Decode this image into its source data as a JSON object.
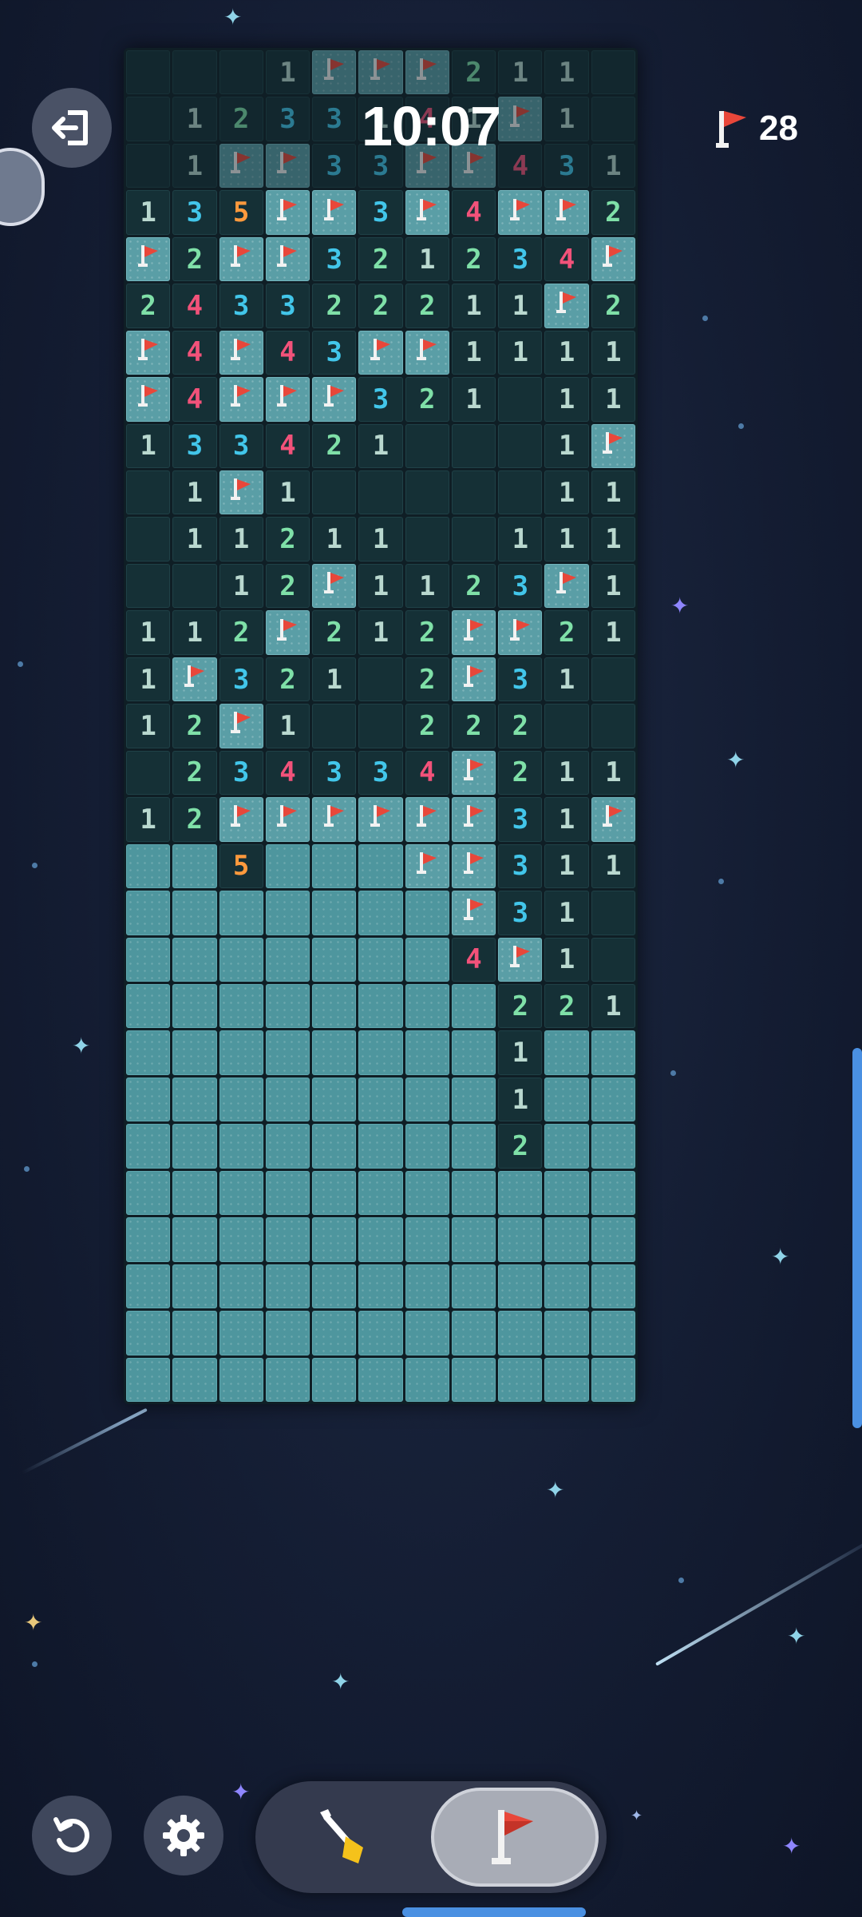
{
  "timer": "10:07",
  "flags_remaining": "28",
  "board": {
    "rows": [
      [
        " ",
        " ",
        " ",
        "1",
        "F",
        "F",
        "F",
        "2",
        "1",
        "1",
        " "
      ],
      [
        " ",
        "1",
        "2",
        "3",
        "3",
        "1",
        "4",
        "1",
        "F",
        "1",
        " "
      ],
      [
        " ",
        "1",
        "F",
        "F",
        "3",
        "3",
        "F",
        "F",
        "4",
        "3",
        "1"
      ],
      [
        "1",
        "3",
        "5",
        "F",
        "F",
        "3",
        "F",
        "4",
        "F",
        "F",
        "2"
      ],
      [
        "F",
        "2",
        "F",
        "F",
        "3",
        "2",
        "1",
        "2",
        "3",
        "4",
        "F"
      ],
      [
        "2",
        "4",
        "3",
        "3",
        "2",
        "2",
        "2",
        "1",
        "1",
        "F",
        "2"
      ],
      [
        "F",
        "4",
        "F",
        "4",
        "3",
        "F",
        "F",
        "1",
        "1",
        "1",
        "1"
      ],
      [
        "F",
        "4",
        "F",
        "F",
        "F",
        "3",
        "2",
        "1",
        " ",
        "1",
        "1"
      ],
      [
        "1",
        "3",
        "3",
        "4",
        "2",
        "1",
        " ",
        " ",
        " ",
        "1",
        "F"
      ],
      [
        " ",
        "1",
        "F",
        "1",
        " ",
        " ",
        " ",
        " ",
        " ",
        "1",
        "1"
      ],
      [
        " ",
        "1",
        "1",
        "2",
        "1",
        "1",
        " ",
        " ",
        "1",
        "1",
        "1"
      ],
      [
        " ",
        " ",
        "1",
        "2",
        "F",
        "1",
        "1",
        "2",
        "3",
        "F",
        "1"
      ],
      [
        "1",
        "1",
        "2",
        "F",
        "2",
        "1",
        "2",
        "F",
        "F",
        "2",
        "1"
      ],
      [
        "1",
        "F",
        "3",
        "2",
        "1",
        " ",
        "2",
        "F",
        "3",
        "1",
        " "
      ],
      [
        "1",
        "2",
        "F",
        "1",
        " ",
        " ",
        "2",
        "2",
        "2",
        " ",
        " "
      ],
      [
        " ",
        "2",
        "3",
        "4",
        "3",
        "3",
        "4",
        "F",
        "2",
        "1",
        "1"
      ],
      [
        "1",
        "2",
        "F",
        "F",
        "F",
        "F",
        "F",
        "F",
        "3",
        "1",
        "F"
      ],
      [
        "H",
        "H",
        "5",
        "H",
        "H",
        "H",
        "F",
        "F",
        "3",
        "1",
        "1"
      ],
      [
        "H",
        "H",
        "H",
        "H",
        "H",
        "H",
        "H",
        "F",
        "3",
        "1",
        " "
      ],
      [
        "H",
        "H",
        "H",
        "H",
        "H",
        "H",
        "H",
        "4",
        "F",
        "1",
        " "
      ],
      [
        "H",
        "H",
        "H",
        "H",
        "H",
        "H",
        "H",
        "H",
        "2",
        "2",
        "1"
      ],
      [
        "H",
        "H",
        "H",
        "H",
        "H",
        "H",
        "H",
        "H",
        "1",
        "H",
        "H"
      ],
      [
        "H",
        "H",
        "H",
        "H",
        "H",
        "H",
        "H",
        "H",
        "1",
        "H",
        "H"
      ],
      [
        "H",
        "H",
        "H",
        "H",
        "H",
        "H",
        "H",
        "H",
        "2",
        "H",
        "H"
      ],
      [
        "H",
        "H",
        "H",
        "H",
        "H",
        "H",
        "H",
        "H",
        "H",
        "H",
        "H"
      ],
      [
        "H",
        "H",
        "H",
        "H",
        "H",
        "H",
        "H",
        "H",
        "H",
        "H",
        "H"
      ],
      [
        "H",
        "H",
        "H",
        "H",
        "H",
        "H",
        "H",
        "H",
        "H",
        "H",
        "H"
      ],
      [
        "H",
        "H",
        "H",
        "H",
        "H",
        "H",
        "H",
        "H",
        "H",
        "H",
        "H"
      ],
      [
        "H",
        "H",
        "H",
        "H",
        "H",
        "H",
        "H",
        "H",
        "H",
        "H",
        "H"
      ]
    ]
  },
  "colors": {
    "number_1": "#b9d8cf",
    "number_2": "#7fe0a8",
    "number_3": "#42c6ea",
    "number_4": "#f2527a",
    "number_5": "#ff9a3d",
    "flag_red": "#e8473a",
    "accent_blue": "#4a90e2"
  },
  "controls": {
    "exit_icon": "exit-door-icon",
    "restart_icon": "restart-icon",
    "settings_icon": "gear-icon",
    "dig_mode_icon": "shovel-icon",
    "flag_mode_icon": "flag-icon",
    "active_mode": "flag"
  }
}
